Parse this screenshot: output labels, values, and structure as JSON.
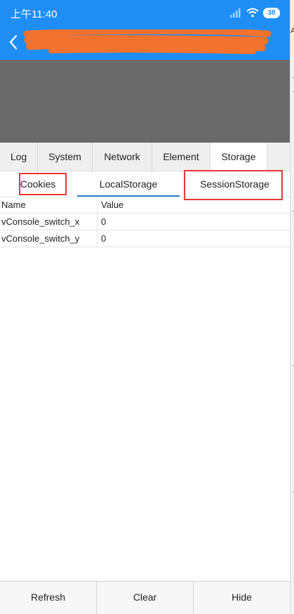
{
  "status_bar": {
    "time": "上午11:40",
    "battery": "38"
  },
  "nav": {
    "title_redacted": true,
    "right_edge_char": "A"
  },
  "tabs": [
    {
      "label": "Log",
      "active": false
    },
    {
      "label": "System",
      "active": false
    },
    {
      "label": "Network",
      "active": false
    },
    {
      "label": "Element",
      "active": false
    },
    {
      "label": "Storage",
      "active": true
    }
  ],
  "subtabs": [
    {
      "label": "Cookies",
      "active": false
    },
    {
      "label": "LocalStorage",
      "active": true
    },
    {
      "label": "SessionStorage",
      "active": false
    }
  ],
  "table": {
    "headers": [
      "Name",
      "Value"
    ],
    "rows": [
      [
        "vConsole_switch_x",
        "0"
      ],
      [
        "vConsole_switch_y",
        "0"
      ]
    ]
  },
  "footer": {
    "refresh": "Refresh",
    "clear": "Clear",
    "hide": "Hide"
  },
  "colors": {
    "accent": "#1e8ef5",
    "highlight": "#e53935",
    "redaction": "#f2722e"
  }
}
